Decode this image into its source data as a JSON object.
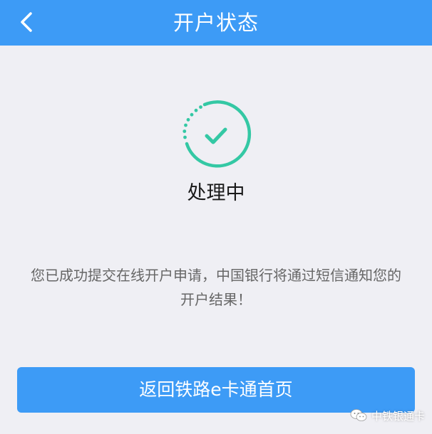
{
  "nav": {
    "title": "开户状态",
    "back_icon": "chevron-left-icon"
  },
  "status": {
    "icon": "processing-check-icon",
    "label": "处理中",
    "accent_color": "#34c8a4"
  },
  "message": {
    "text": "您已成功提交在线开户申请，中国银行将通过短信通知您的开户结果！"
  },
  "actions": {
    "home_label": "返回铁路e卡通首页"
  },
  "watermark": {
    "icon": "wechat-icon",
    "text": "中铁银通卡"
  },
  "colors": {
    "primary": "#3d9bf6",
    "background": "#efeff4"
  }
}
